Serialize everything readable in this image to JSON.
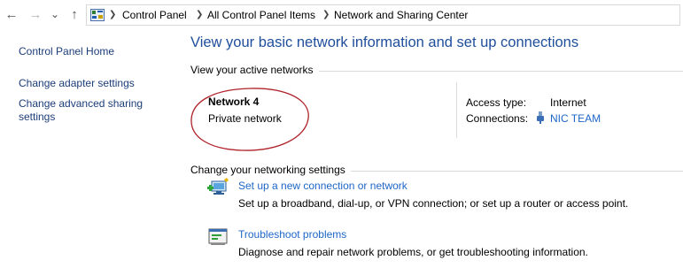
{
  "address_bar": {
    "breadcrumbs": [
      "Control Panel",
      "All Control Panel Items",
      "Network and Sharing Center"
    ],
    "back_icon": "arrow-left",
    "forward_icon": "arrow-right",
    "recent_icon": "chevron-down",
    "up_icon": "arrow-up"
  },
  "sidebar": {
    "items": [
      {
        "label": "Control Panel Home"
      },
      {
        "label": "Change adapter settings"
      },
      {
        "label": "Change advanced sharing"
      },
      {
        "label": "settings"
      }
    ]
  },
  "main": {
    "title": "View your basic network information and set up connections",
    "active_networks": {
      "heading": "View your active networks",
      "network_name": "Network 4",
      "network_category": "Private network",
      "access_type_label": "Access type:",
      "access_type_value": "Internet",
      "connections_label": "Connections:",
      "connections_value": "NIC TEAM"
    },
    "settings": {
      "heading": "Change your networking settings",
      "tasks": [
        {
          "icon": "new-connection-icon",
          "label": "Set up a new connection or network",
          "description": "Set up a broadband, dial-up, or VPN connection; or set up a router or access point."
        },
        {
          "icon": "troubleshoot-icon",
          "label": "Troubleshoot problems",
          "description": "Diagnose and repair network problems, or get troubleshooting information."
        }
      ]
    }
  },
  "colors": {
    "title": "#1e4e9c",
    "link": "#1e66c8",
    "sidebar_link": "#1c3d7a",
    "annotation": "#b0222a",
    "divider": "#dadada"
  }
}
